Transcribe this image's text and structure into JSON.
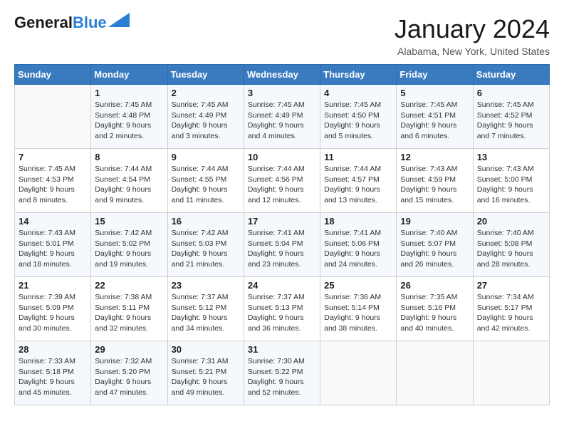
{
  "header": {
    "logo_general": "General",
    "logo_blue": "Blue",
    "title": "January 2024",
    "subtitle": "Alabama, New York, United States"
  },
  "weekdays": [
    "Sunday",
    "Monday",
    "Tuesday",
    "Wednesday",
    "Thursday",
    "Friday",
    "Saturday"
  ],
  "weeks": [
    [
      {
        "day": "",
        "info": ""
      },
      {
        "day": "1",
        "info": "Sunrise: 7:45 AM\nSunset: 4:48 PM\nDaylight: 9 hours\nand 2 minutes."
      },
      {
        "day": "2",
        "info": "Sunrise: 7:45 AM\nSunset: 4:49 PM\nDaylight: 9 hours\nand 3 minutes."
      },
      {
        "day": "3",
        "info": "Sunrise: 7:45 AM\nSunset: 4:49 PM\nDaylight: 9 hours\nand 4 minutes."
      },
      {
        "day": "4",
        "info": "Sunrise: 7:45 AM\nSunset: 4:50 PM\nDaylight: 9 hours\nand 5 minutes."
      },
      {
        "day": "5",
        "info": "Sunrise: 7:45 AM\nSunset: 4:51 PM\nDaylight: 9 hours\nand 6 minutes."
      },
      {
        "day": "6",
        "info": "Sunrise: 7:45 AM\nSunset: 4:52 PM\nDaylight: 9 hours\nand 7 minutes."
      }
    ],
    [
      {
        "day": "7",
        "info": "Sunrise: 7:45 AM\nSunset: 4:53 PM\nDaylight: 9 hours\nand 8 minutes."
      },
      {
        "day": "8",
        "info": "Sunrise: 7:44 AM\nSunset: 4:54 PM\nDaylight: 9 hours\nand 9 minutes."
      },
      {
        "day": "9",
        "info": "Sunrise: 7:44 AM\nSunset: 4:55 PM\nDaylight: 9 hours\nand 11 minutes."
      },
      {
        "day": "10",
        "info": "Sunrise: 7:44 AM\nSunset: 4:56 PM\nDaylight: 9 hours\nand 12 minutes."
      },
      {
        "day": "11",
        "info": "Sunrise: 7:44 AM\nSunset: 4:57 PM\nDaylight: 9 hours\nand 13 minutes."
      },
      {
        "day": "12",
        "info": "Sunrise: 7:43 AM\nSunset: 4:59 PM\nDaylight: 9 hours\nand 15 minutes."
      },
      {
        "day": "13",
        "info": "Sunrise: 7:43 AM\nSunset: 5:00 PM\nDaylight: 9 hours\nand 16 minutes."
      }
    ],
    [
      {
        "day": "14",
        "info": "Sunrise: 7:43 AM\nSunset: 5:01 PM\nDaylight: 9 hours\nand 18 minutes."
      },
      {
        "day": "15",
        "info": "Sunrise: 7:42 AM\nSunset: 5:02 PM\nDaylight: 9 hours\nand 19 minutes."
      },
      {
        "day": "16",
        "info": "Sunrise: 7:42 AM\nSunset: 5:03 PM\nDaylight: 9 hours\nand 21 minutes."
      },
      {
        "day": "17",
        "info": "Sunrise: 7:41 AM\nSunset: 5:04 PM\nDaylight: 9 hours\nand 23 minutes."
      },
      {
        "day": "18",
        "info": "Sunrise: 7:41 AM\nSunset: 5:06 PM\nDaylight: 9 hours\nand 24 minutes."
      },
      {
        "day": "19",
        "info": "Sunrise: 7:40 AM\nSunset: 5:07 PM\nDaylight: 9 hours\nand 26 minutes."
      },
      {
        "day": "20",
        "info": "Sunrise: 7:40 AM\nSunset: 5:08 PM\nDaylight: 9 hours\nand 28 minutes."
      }
    ],
    [
      {
        "day": "21",
        "info": "Sunrise: 7:39 AM\nSunset: 5:09 PM\nDaylight: 9 hours\nand 30 minutes."
      },
      {
        "day": "22",
        "info": "Sunrise: 7:38 AM\nSunset: 5:11 PM\nDaylight: 9 hours\nand 32 minutes."
      },
      {
        "day": "23",
        "info": "Sunrise: 7:37 AM\nSunset: 5:12 PM\nDaylight: 9 hours\nand 34 minutes."
      },
      {
        "day": "24",
        "info": "Sunrise: 7:37 AM\nSunset: 5:13 PM\nDaylight: 9 hours\nand 36 minutes."
      },
      {
        "day": "25",
        "info": "Sunrise: 7:36 AM\nSunset: 5:14 PM\nDaylight: 9 hours\nand 38 minutes."
      },
      {
        "day": "26",
        "info": "Sunrise: 7:35 AM\nSunset: 5:16 PM\nDaylight: 9 hours\nand 40 minutes."
      },
      {
        "day": "27",
        "info": "Sunrise: 7:34 AM\nSunset: 5:17 PM\nDaylight: 9 hours\nand 42 minutes."
      }
    ],
    [
      {
        "day": "28",
        "info": "Sunrise: 7:33 AM\nSunset: 5:18 PM\nDaylight: 9 hours\nand 45 minutes."
      },
      {
        "day": "29",
        "info": "Sunrise: 7:32 AM\nSunset: 5:20 PM\nDaylight: 9 hours\nand 47 minutes."
      },
      {
        "day": "30",
        "info": "Sunrise: 7:31 AM\nSunset: 5:21 PM\nDaylight: 9 hours\nand 49 minutes."
      },
      {
        "day": "31",
        "info": "Sunrise: 7:30 AM\nSunset: 5:22 PM\nDaylight: 9 hours\nand 52 minutes."
      },
      {
        "day": "",
        "info": ""
      },
      {
        "day": "",
        "info": ""
      },
      {
        "day": "",
        "info": ""
      }
    ]
  ]
}
